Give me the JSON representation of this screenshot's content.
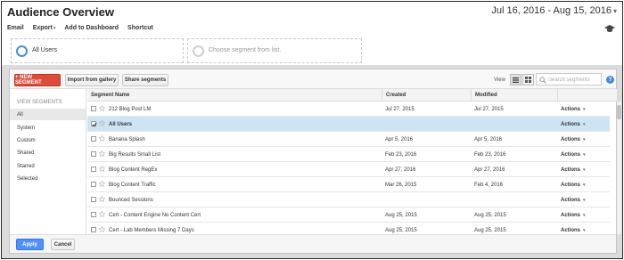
{
  "header": {
    "title": "Audience Overview",
    "date_range": "Jul 16, 2016 - Aug 15, 2016"
  },
  "toolbar": {
    "email": "Email",
    "export": "Export",
    "add_dashboard": "Add to Dashboard",
    "shortcut": "Shortcut"
  },
  "segments": {
    "slot1": "All Users",
    "slot2_placeholder": "Choose segment from list."
  },
  "panel": {
    "new_segment": "+ NEW SEGMENT",
    "import_gallery": "Import from gallery",
    "share_segments": "Share segments",
    "view_label": "View",
    "search_placeholder": "Search segments",
    "help": "?"
  },
  "sidebar": {
    "heading": "VIEW SEGMENTS",
    "items": [
      {
        "label": "All",
        "active": true
      },
      {
        "label": "System",
        "active": false
      },
      {
        "label": "Custom",
        "active": false
      },
      {
        "label": "Shared",
        "active": false
      },
      {
        "label": "Starred",
        "active": false
      },
      {
        "label": "Selected",
        "active": false
      }
    ]
  },
  "table": {
    "columns": {
      "name": "Segment Name",
      "created": "Created",
      "modified": "Modified"
    },
    "action_label": "Actions",
    "rows": [
      {
        "name": "212 Blog Post LM",
        "created": "Jul 27, 2015",
        "modified": "Jul 27, 2015",
        "selected": false
      },
      {
        "name": "All Users",
        "created": "",
        "modified": "",
        "selected": true
      },
      {
        "name": "Banana Splash",
        "created": "Apr 5, 2016",
        "modified": "Apr 5, 2016",
        "selected": false
      },
      {
        "name": "Big Results Small List",
        "created": "Feb 23, 2016",
        "modified": "Feb 23, 2016",
        "selected": false
      },
      {
        "name": "Blog Content RegEx",
        "created": "Apr 27, 2016",
        "modified": "Apr 27, 2016",
        "selected": false
      },
      {
        "name": "Blog Content Traffic",
        "created": "Mar 26, 2015",
        "modified": "Feb 4, 2016",
        "selected": false
      },
      {
        "name": "Bounced Sessions",
        "created": "",
        "modified": "",
        "selected": false
      },
      {
        "name": "Cert - Content Engine No Content Cert",
        "created": "Aug 25, 2015",
        "modified": "Aug 25, 2015",
        "selected": false
      },
      {
        "name": "Cert - Lab Members Missing 7 Days",
        "created": "Aug 25, 2015",
        "modified": "Aug 25, 2015",
        "selected": false
      }
    ]
  },
  "footer": {
    "apply": "Apply",
    "cancel": "Cancel"
  },
  "colors": {
    "new_segment_red": "#dd4b39",
    "apply_blue": "#4d90fe",
    "selected_row": "#cde5f3",
    "segment_ring": "#4a90d9"
  }
}
